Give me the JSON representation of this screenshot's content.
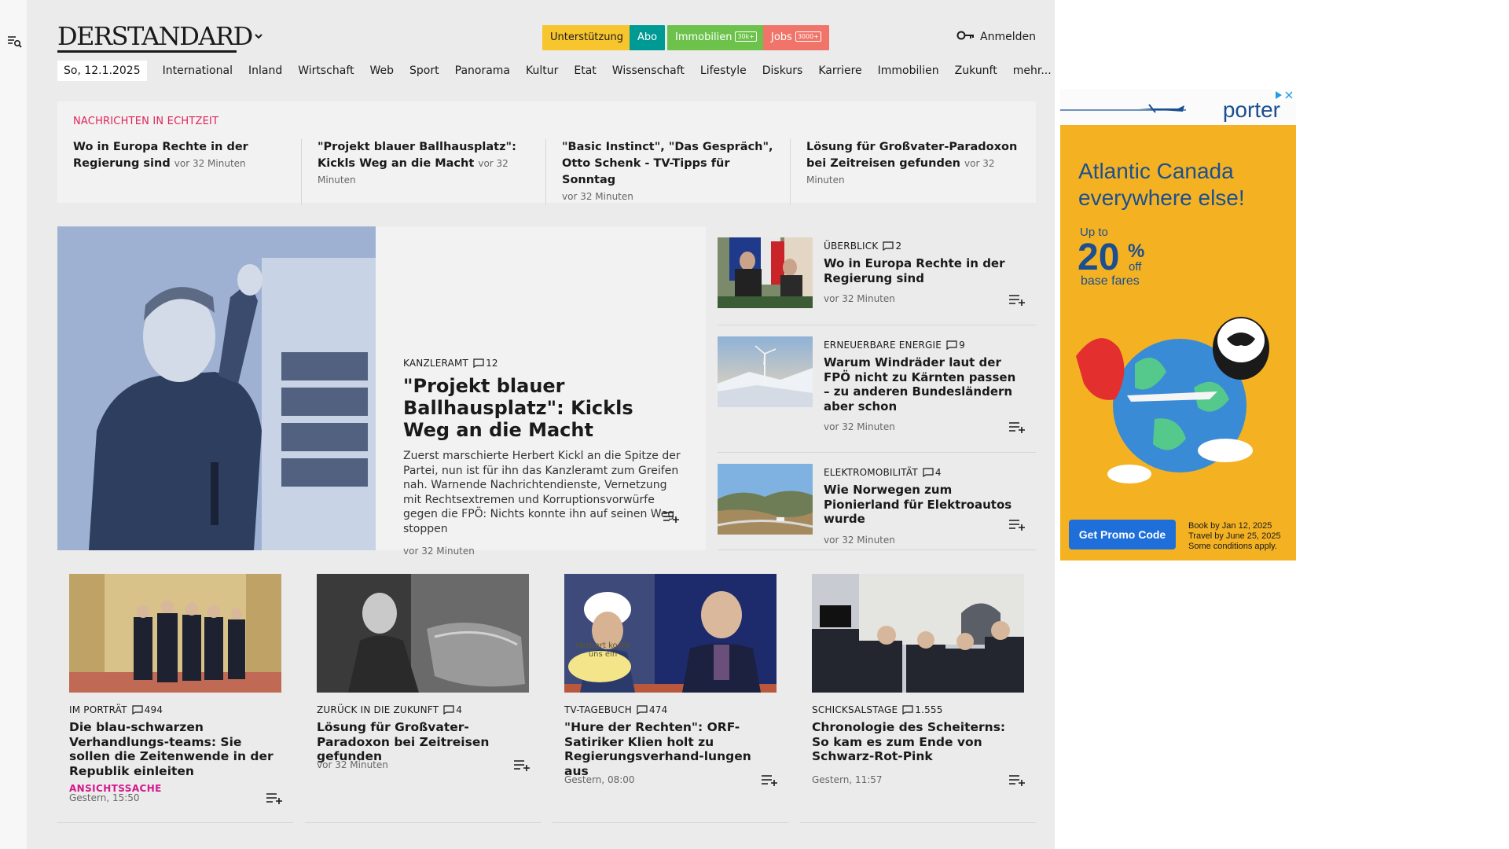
{
  "site": {
    "logo": "DERSTANDARD"
  },
  "header": {
    "support_label": "Unterstützung",
    "abo_label": "Abo",
    "immo_label": "Immobilien",
    "immo_count": "30k+",
    "jobs_label": "Jobs",
    "jobs_count": "3000+",
    "login_label": "Anmelden"
  },
  "nav": {
    "date": "So, 12.1.2025",
    "items": [
      "International",
      "Inland",
      "Wirtschaft",
      "Web",
      "Sport",
      "Panorama",
      "Kultur",
      "Etat",
      "Wissenschaft",
      "Lifestyle",
      "Diskurs",
      "Karriere",
      "Immobilien",
      "Zukunft",
      "mehr..."
    ]
  },
  "ticker": {
    "heading": "NACHRICHTEN IN ECHTZEIT",
    "items": [
      {
        "title": "Wo in Europa Rechte in der Regierung sind",
        "time": "vor 32 Minuten"
      },
      {
        "title": "\"Projekt blauer Ballhausplatz\": Kickls Weg an die Macht",
        "time": "vor 32 Minuten"
      },
      {
        "title": "\"Basic Instinct\", \"Das Gespräch\", Otto Schenk - TV-Tipps für Sonntag",
        "time": "vor 32 Minuten"
      },
      {
        "title": "Lösung für Großvater-Paradoxon bei Zeitreisen gefunden",
        "time": "vor 32 Minuten"
      }
    ]
  },
  "lead": {
    "kicker": "KANZLERAMT",
    "comments": "12",
    "title": "\"Projekt blauer Ballhausplatz\": Kickls Weg an die Macht",
    "teaser": "Zuerst marschierte Herbert Kickl an die Spitze der Partei, nun ist für ihn das Kanzleramt zum Greifen nah. Warnende Nachrichtendienste, Vernetzung mit Rechtsextremen und Korruptionsvorwürfe gegen die FPÖ: Nichts konnte ihn auf seinen Weg stoppen",
    "time": "vor 32 Minuten"
  },
  "side": [
    {
      "kicker": "ÜBERBLICK",
      "comments": "2",
      "title": "Wo in Europa Rechte in der Regierung sind",
      "time": "vor 32 Minuten"
    },
    {
      "kicker": "ERNEUERBARE ENERGIE",
      "comments": "9",
      "title": "Warum Windräder laut der FPÖ nicht zu Kärnten passen – zu anderen Bundesländern aber schon",
      "time": "vor 32 Minuten"
    },
    {
      "kicker": "ELEKTROMOBILITÄT",
      "comments": "4",
      "title": "Wie Norwegen zum Pionierland für Elektroautos wurde",
      "time": "vor 32 Minuten"
    }
  ],
  "cards": [
    {
      "kicker": "IM PORTRÄT",
      "comments": "494",
      "title": "Die blau-schwarzen Verhandlungs-teams: Sie sollen die Zeitenwende in der Republik einleiten",
      "tag": "ANSICHTSSACHE",
      "time": "Gestern, 15:50"
    },
    {
      "kicker": "ZURÜCK IN DIE ZUKUNFT",
      "comments": "4",
      "title": "Lösung für Großvater-Paradoxon bei Zeitreisen gefunden",
      "tag": "",
      "time": "vor 32 Minuten"
    },
    {
      "kicker": "TV-TAGEBUCH",
      "comments": "474",
      "title": "\"Hure der Rechten\": ORF-Satiriker Klien holt zu Regierungsverhand-lungen aus",
      "tag": "",
      "time": "Gestern, 08:00"
    },
    {
      "kicker": "SCHICKSALSTAGE",
      "comments": "1.555",
      "title": "Chronologie des Scheiterns: So kam es zum Ende von Schwarz-Rot-Pink",
      "tag": "",
      "time": "Gestern, 11:57"
    }
  ],
  "ad": {
    "brand": "porter",
    "headline": "Atlantic Canada everywhere else!",
    "up_to": "Up to",
    "percent": "20",
    "pct_sign": "%",
    "off": "off",
    "base_fares": "base fares",
    "cta": "Get Promo Code",
    "fine1": "Book by Jan 12, 2025",
    "fine2": "Travel by June 25, 2025",
    "fine3": "Some conditions apply.",
    "mug_text": "Herbert kocht uns ein"
  },
  "colors": {
    "accent_red": "#e0235a",
    "tag_pink": "#d6168c",
    "support": "#f7c52e",
    "abo": "#009a95",
    "immo": "#6cc24a",
    "jobs": "#f07469",
    "ad_bg": "#f4b223",
    "ad_blue": "#1b4f8f",
    "cta_blue": "#1e6fd9"
  }
}
